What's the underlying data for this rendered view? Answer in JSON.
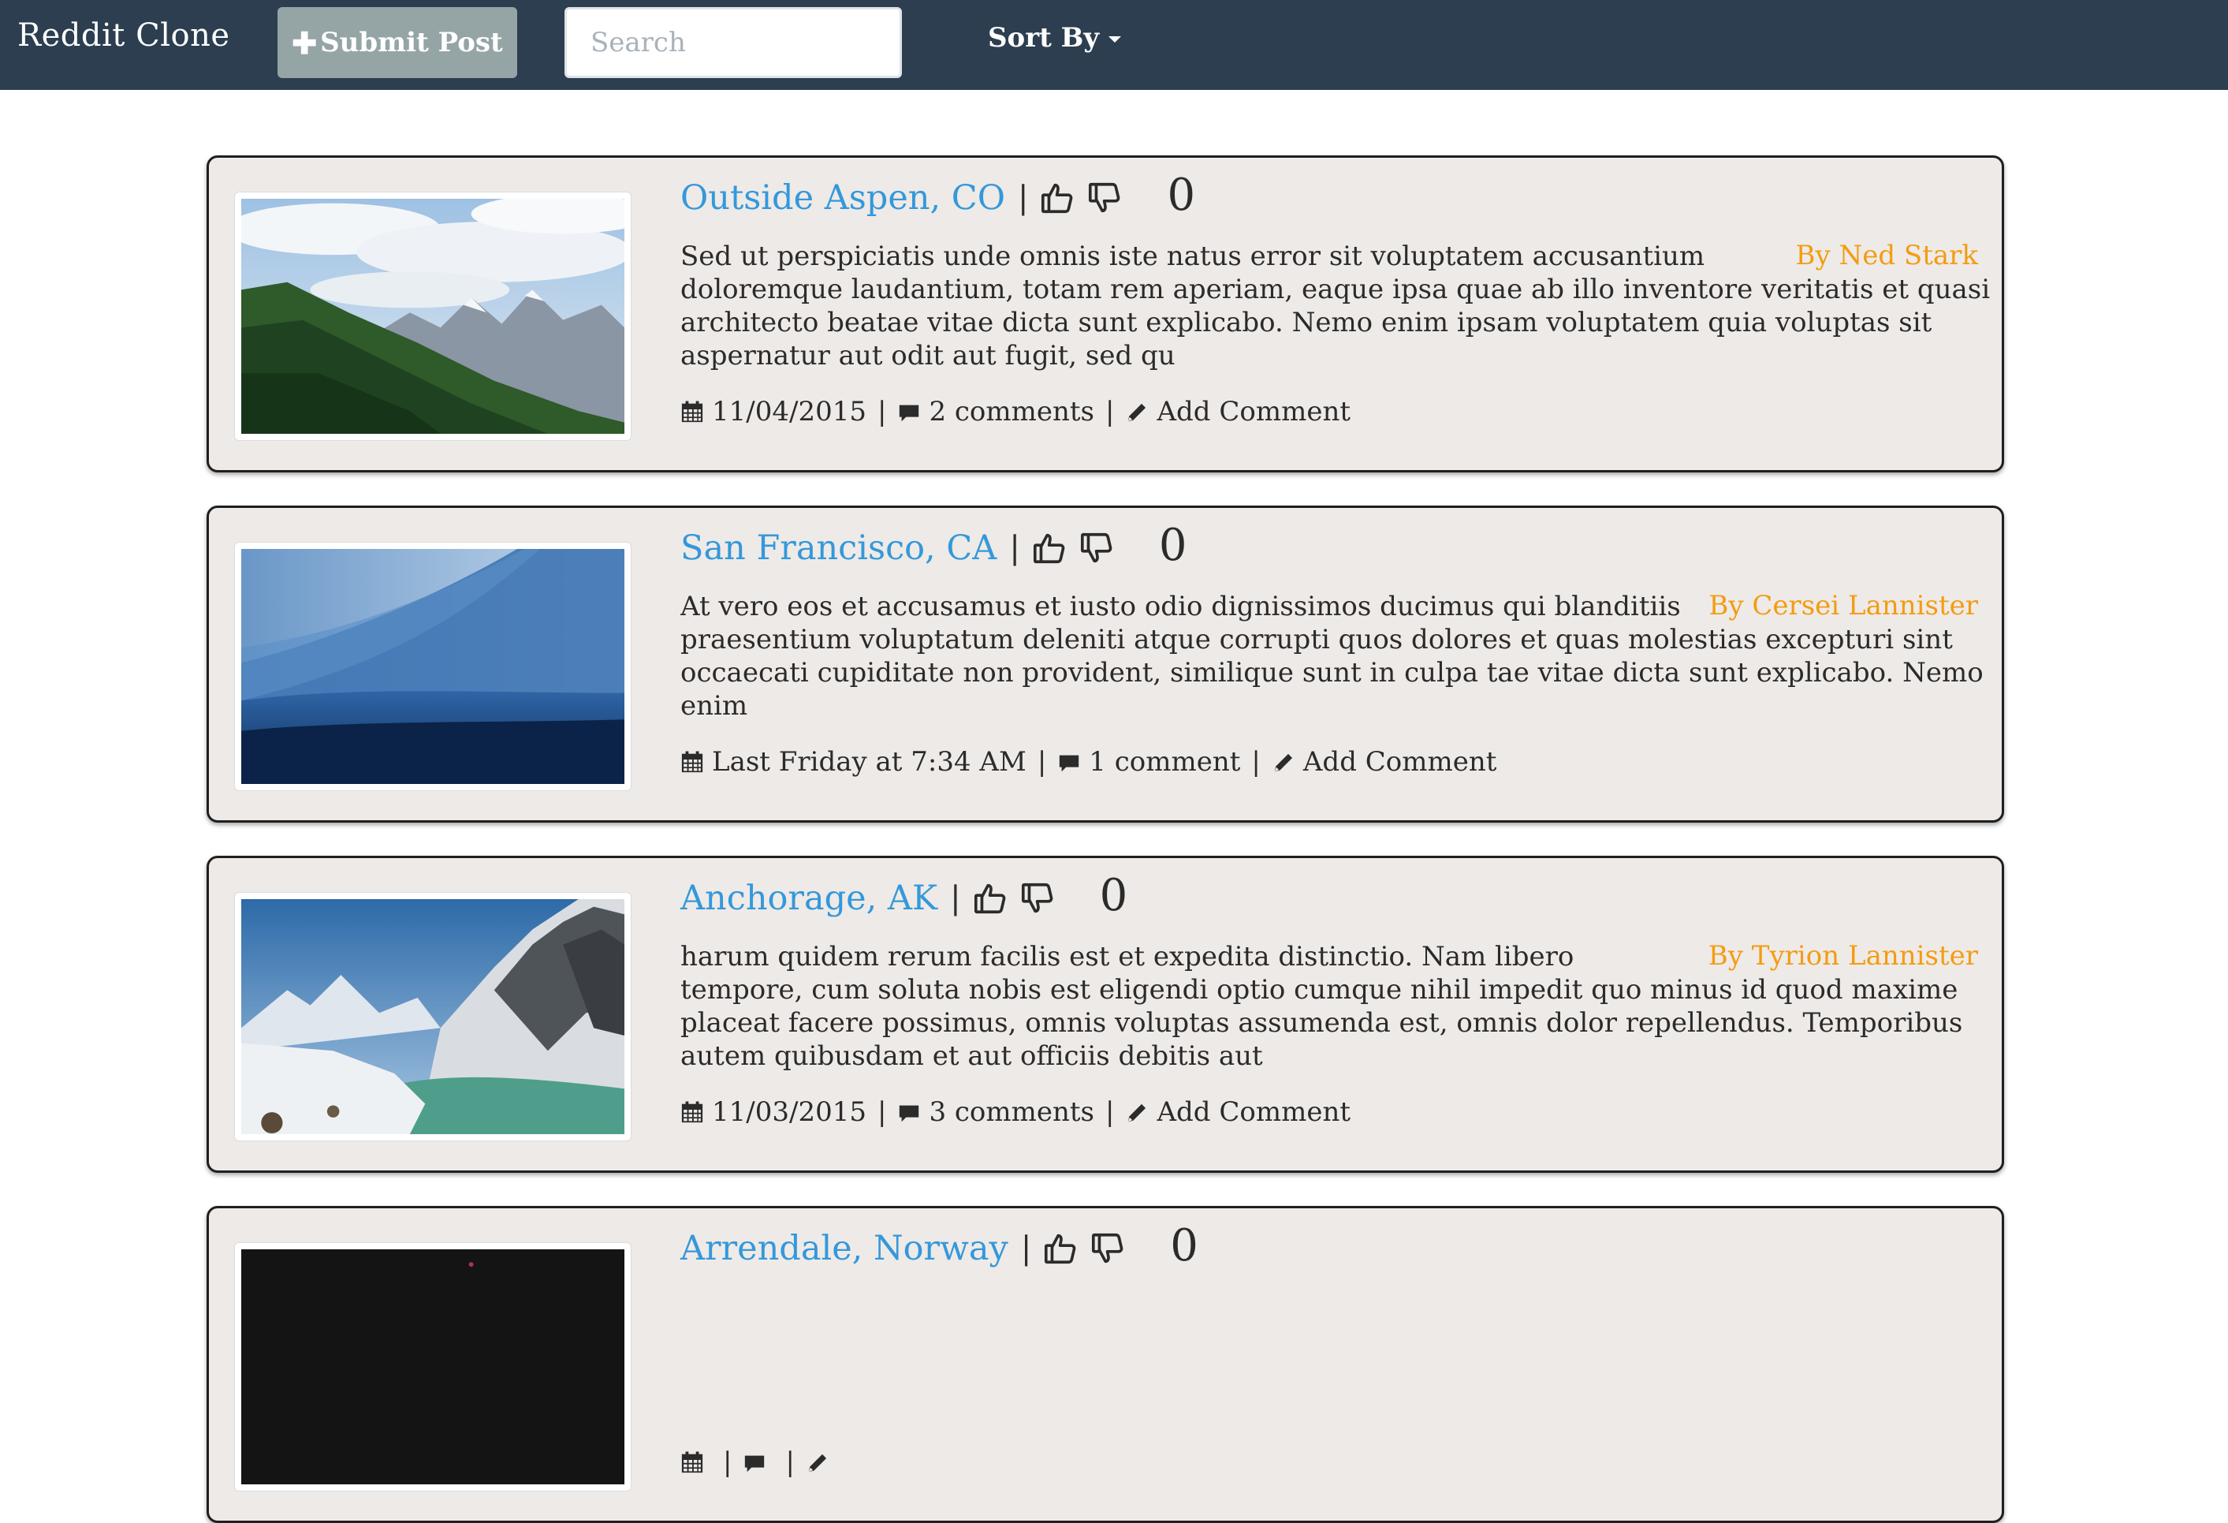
{
  "navbar": {
    "brand": "Reddit Clone",
    "submit_label": "Submit Post",
    "search_placeholder": "Search",
    "sort_label": "Sort By"
  },
  "colors": {
    "navbar": "#2c3e50",
    "submit_button": "#95a5a6",
    "title_link": "#3498db",
    "author": "#f39c12",
    "card_background": "#eeeae7"
  },
  "posts": [
    {
      "title": "Outside Aspen, CO",
      "votes": "0",
      "author": "By Ned Stark",
      "excerpt": "Sed ut perspiciatis unde omnis iste natus error sit voluptatem accusantium doloremque laudantium, totam rem aperiam, eaque ipsa quae ab illo inventore veritatis et quasi architecto beatae vitae dicta sunt explicabo. Nemo enim ipsam voluptatem quia voluptas sit aspernatur aut odit aut fugit, sed qu",
      "date": "11/04/2015",
      "comments": "2 comments",
      "add_comment": "Add Comment",
      "image": "mountain-forest"
    },
    {
      "title": "San Francisco, CA",
      "votes": "0",
      "author": "By Cersei Lannister",
      "excerpt": "At vero eos et accusamus et iusto odio dignissimos ducimus qui blanditiis praesentium voluptatum deleniti atque corrupti quos dolores et quas molestias excepturi sint occaecati cupiditate non provident, similique sunt in culpa tae vitae dicta sunt explicabo. Nemo enim",
      "date": "Last Friday at 7:34 AM",
      "comments": "1 comment",
      "add_comment": "Add Comment",
      "image": "ocean-wave"
    },
    {
      "title": "Anchorage, AK",
      "votes": "0",
      "author": "By Tyrion Lannister",
      "excerpt": "harum quidem rerum facilis est et expedita distinctio. Nam libero tempore, cum soluta nobis est eligendi optio cumque nihil impedit quo minus id quod maxime placeat facere possimus, omnis voluptas assumenda est, omnis dolor repellendus. Temporibus autem quibusdam et aut officiis debitis aut",
      "date": "11/03/2015",
      "comments": "3 comments",
      "add_comment": "Add Comment",
      "image": "snowy-lake"
    },
    {
      "title": "Arrendale, Norway",
      "votes": "0",
      "author": "",
      "excerpt": "",
      "date": "",
      "comments": "",
      "add_comment": "",
      "image": "night"
    }
  ]
}
